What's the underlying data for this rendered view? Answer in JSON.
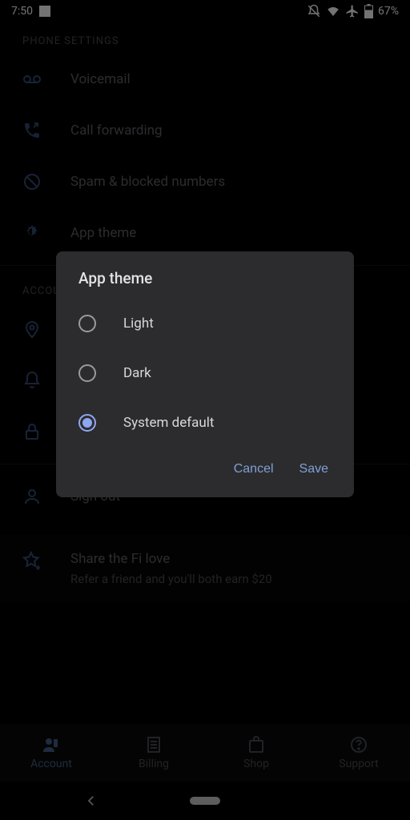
{
  "status": {
    "time": "7:50",
    "battery": "67%"
  },
  "sections": {
    "phone": {
      "heading": "PHONE SETTINGS",
      "items": [
        {
          "label": "Voicemail"
        },
        {
          "label": "Call forwarding"
        },
        {
          "label": "Spam & blocked numbers"
        },
        {
          "label": "App theme"
        }
      ]
    },
    "account": {
      "heading": "ACCOUNT",
      "items": [
        {
          "label": ""
        },
        {
          "label": ""
        },
        {
          "label": ""
        }
      ]
    },
    "signout": {
      "label": "Sign out"
    }
  },
  "promo": {
    "title": "Share the Fi love",
    "sub": "Refer a friend and you'll both earn $20"
  },
  "nav": {
    "items": [
      {
        "label": "Account"
      },
      {
        "label": "Billing"
      },
      {
        "label": "Shop"
      },
      {
        "label": "Support"
      }
    ]
  },
  "dialog": {
    "title": "App theme",
    "options": [
      {
        "label": "Light"
      },
      {
        "label": "Dark"
      },
      {
        "label": "System default"
      }
    ],
    "cancel": "Cancel",
    "save": "Save"
  }
}
